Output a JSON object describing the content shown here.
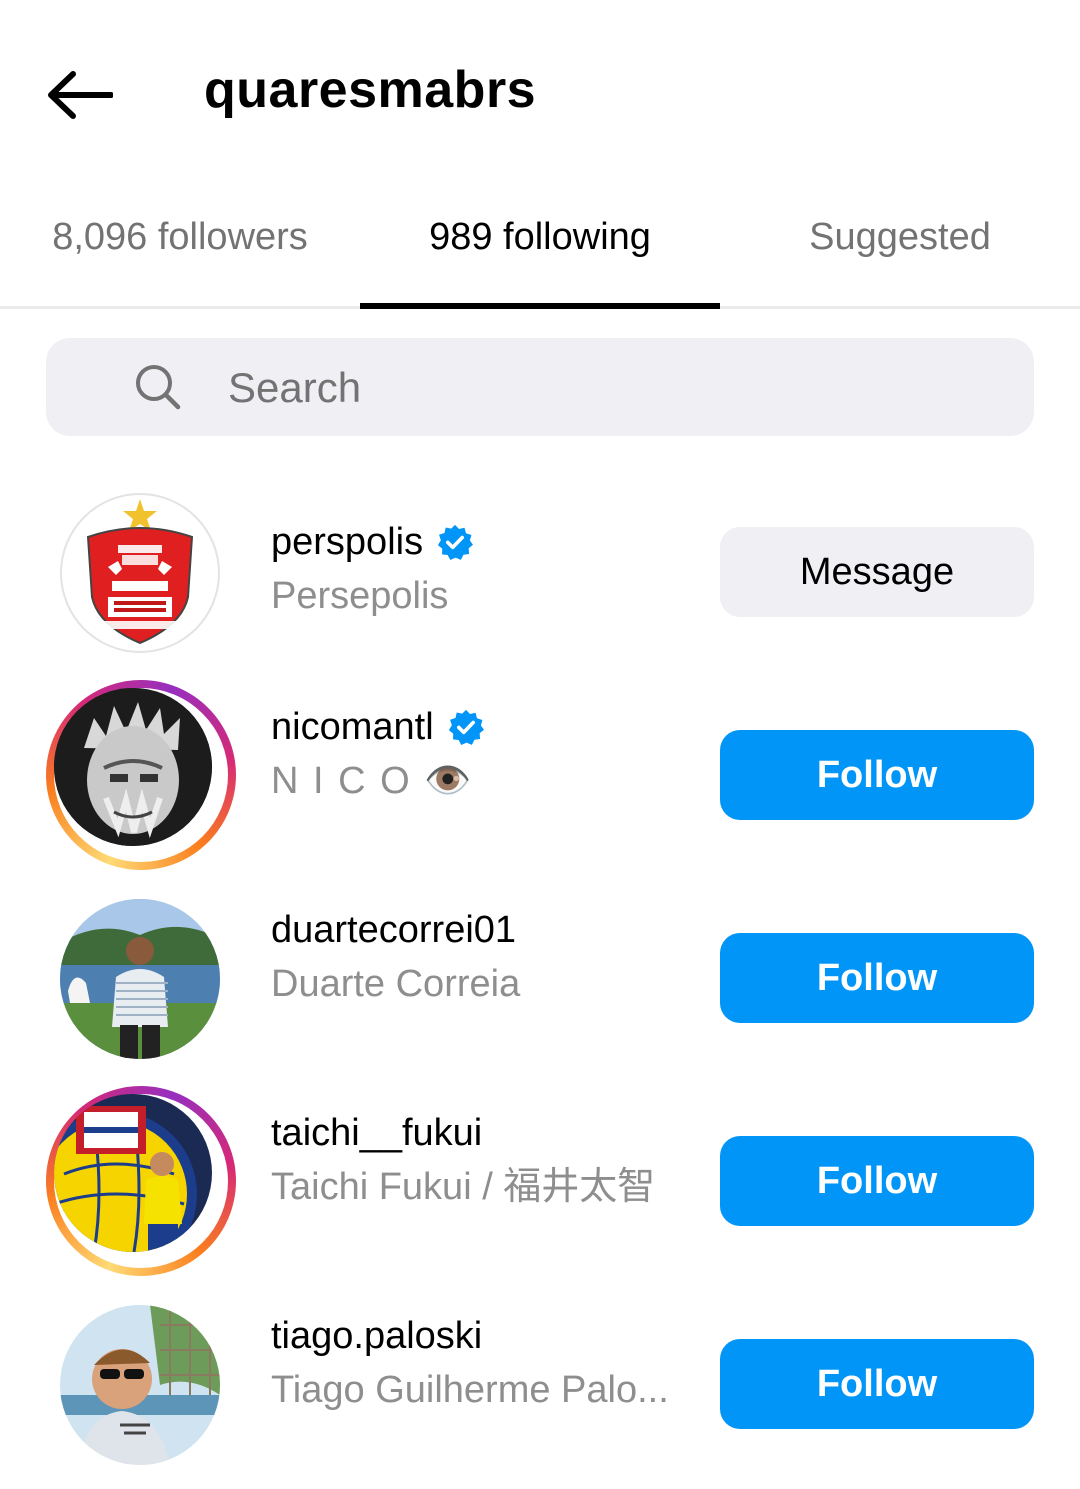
{
  "header": {
    "title": "quaresmabrs",
    "back_icon": "arrow-left-icon"
  },
  "tabs": [
    {
      "label": "8,096 followers",
      "active": false
    },
    {
      "label": "989 following",
      "active": true
    },
    {
      "label": "Suggested",
      "active": false
    }
  ],
  "search": {
    "placeholder": "Search",
    "value": "",
    "icon": "search-icon"
  },
  "accounts": [
    {
      "username": "perspolis",
      "full_name": "Persepolis",
      "verified": true,
      "story_ring": false,
      "avatar": "persepolis-club-crest",
      "button": "Message"
    },
    {
      "username": "nicomantl",
      "full_name": "N I C O 👁️",
      "verified": true,
      "story_ring": true,
      "avatar": "sketch-portrait",
      "button": "Follow"
    },
    {
      "username": "duartecorrei01",
      "full_name": "Duarte Correia",
      "verified": false,
      "story_ring": false,
      "avatar": "man-by-lake-photo",
      "button": "Follow"
    },
    {
      "username": "taichi__fukui",
      "full_name": "Taichi Fukui / 福井太智",
      "verified": false,
      "story_ring": true,
      "avatar": "player-with-club-crest",
      "button": "Follow"
    },
    {
      "username": "tiago.paloski",
      "full_name": "Tiago Guilherme Palo...",
      "verified": false,
      "story_ring": false,
      "avatar": "man-with-sunglasses-photo",
      "button": "Follow"
    }
  ],
  "colors": {
    "follow_button": "#0095f6",
    "message_button": "#efeff4",
    "verified_badge": "#0095f6",
    "secondary_text": "#8e8e8e"
  }
}
